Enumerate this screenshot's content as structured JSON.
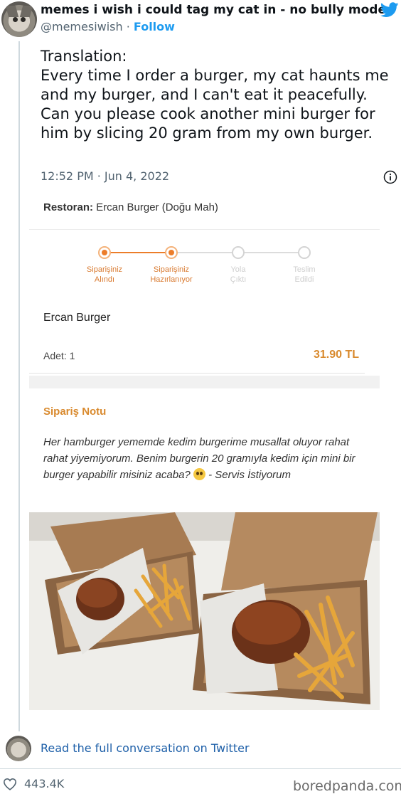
{
  "header": {
    "display_name": "memes i wish i could tag my cat in - no bully mode",
    "handle": "@memesiwish",
    "separator": " · ",
    "follow_label": "Follow",
    "avatar_icon": "cat-avatar",
    "brand_icon": "twitter-bird-icon",
    "brand_color": "#1d9bf0"
  },
  "tweet": {
    "text": "Translation:\nEvery time I order a burger, my cat haunts me and my burger, and I can't eat it peacefully. Can you please cook another mini burger for him by slicing 20 gram from my own burger.",
    "timestamp": "12:52 PM · Jun 4, 2022",
    "info_icon": "info-icon"
  },
  "order": {
    "restaurant_label": "Restoran:",
    "restaurant_value": " Ercan Burger (Doğu Mah)",
    "steps": [
      {
        "label": "Siparişiniz\nAlındı",
        "done": true
      },
      {
        "label": "Siparişiniz\nHazırlanıyor",
        "done": true
      },
      {
        "label": "Yola\nÇıktı",
        "done": false
      },
      {
        "label": "Teslim\nEdildi",
        "done": false
      }
    ],
    "accent_color": "#ec7d2a",
    "item_name": "Ercan Burger",
    "quantity": "Adet: 1",
    "price": "31.90 TL",
    "note_title": "Sipariş Notu",
    "note_text_main": "Her hamburger yememde kedim burgerime musallat oluyor rahat rahat yiyemiyorum. Benim burgerin 20 gramıyla kedim için mini bir burger yapabilir misiniz acaba? ",
    "note_emoji": "pleading-face-emoji",
    "note_text_tail": " - Servis İstiyorum",
    "photo": "photo of two burger boxes with fries, one mini burger"
  },
  "footer": {
    "read_link": "Read the full conversation on Twitter",
    "like_icon": "heart-icon",
    "likes": "443.4K",
    "watermark": "boredpanda.com"
  }
}
